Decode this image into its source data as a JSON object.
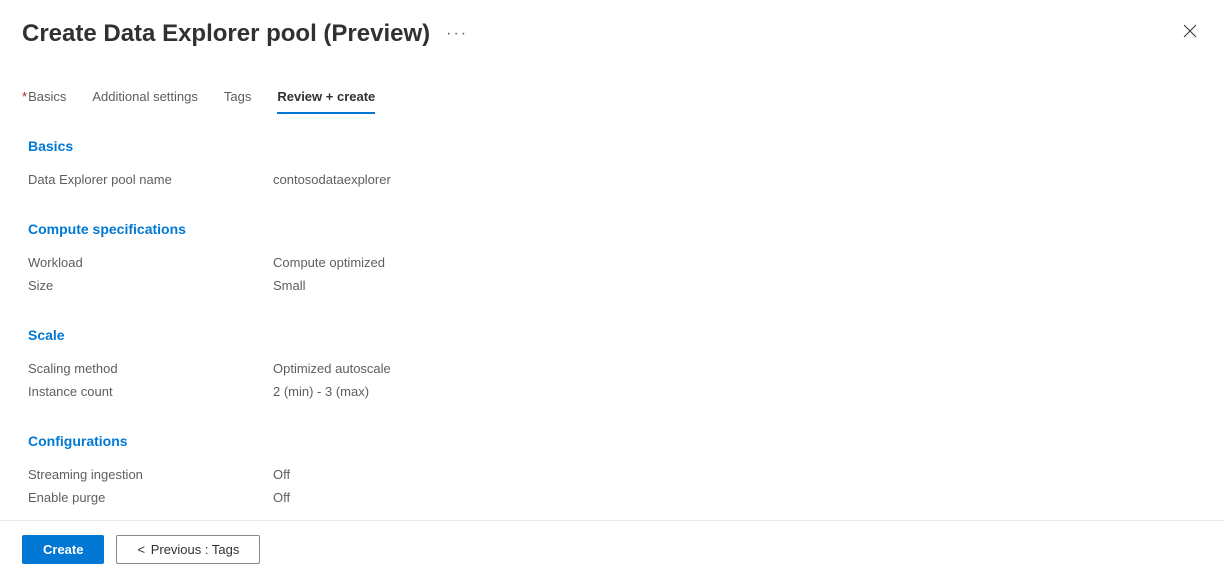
{
  "header": {
    "title": "Create Data Explorer pool (Preview)"
  },
  "tabs": [
    {
      "label": "Basics",
      "required": true,
      "active": false
    },
    {
      "label": "Additional settings",
      "required": false,
      "active": false
    },
    {
      "label": "Tags",
      "required": false,
      "active": false
    },
    {
      "label": "Review + create",
      "required": false,
      "active": true
    }
  ],
  "sections": {
    "basics": {
      "title": "Basics",
      "pool_name_label": "Data Explorer pool name",
      "pool_name_value": "contosodataexplorer"
    },
    "compute": {
      "title": "Compute specifications",
      "workload_label": "Workload",
      "workload_value": "Compute optimized",
      "size_label": "Size",
      "size_value": "Small"
    },
    "scale": {
      "title": "Scale",
      "method_label": "Scaling method",
      "method_value": "Optimized autoscale",
      "instance_label": "Instance count",
      "instance_value": "2 (min) - 3 (max)"
    },
    "configurations": {
      "title": "Configurations",
      "streaming_label": "Streaming ingestion",
      "streaming_value": "Off",
      "purge_label": "Enable purge",
      "purge_value": "Off"
    }
  },
  "footer": {
    "create_label": "Create",
    "previous_label": "Previous : Tags"
  }
}
